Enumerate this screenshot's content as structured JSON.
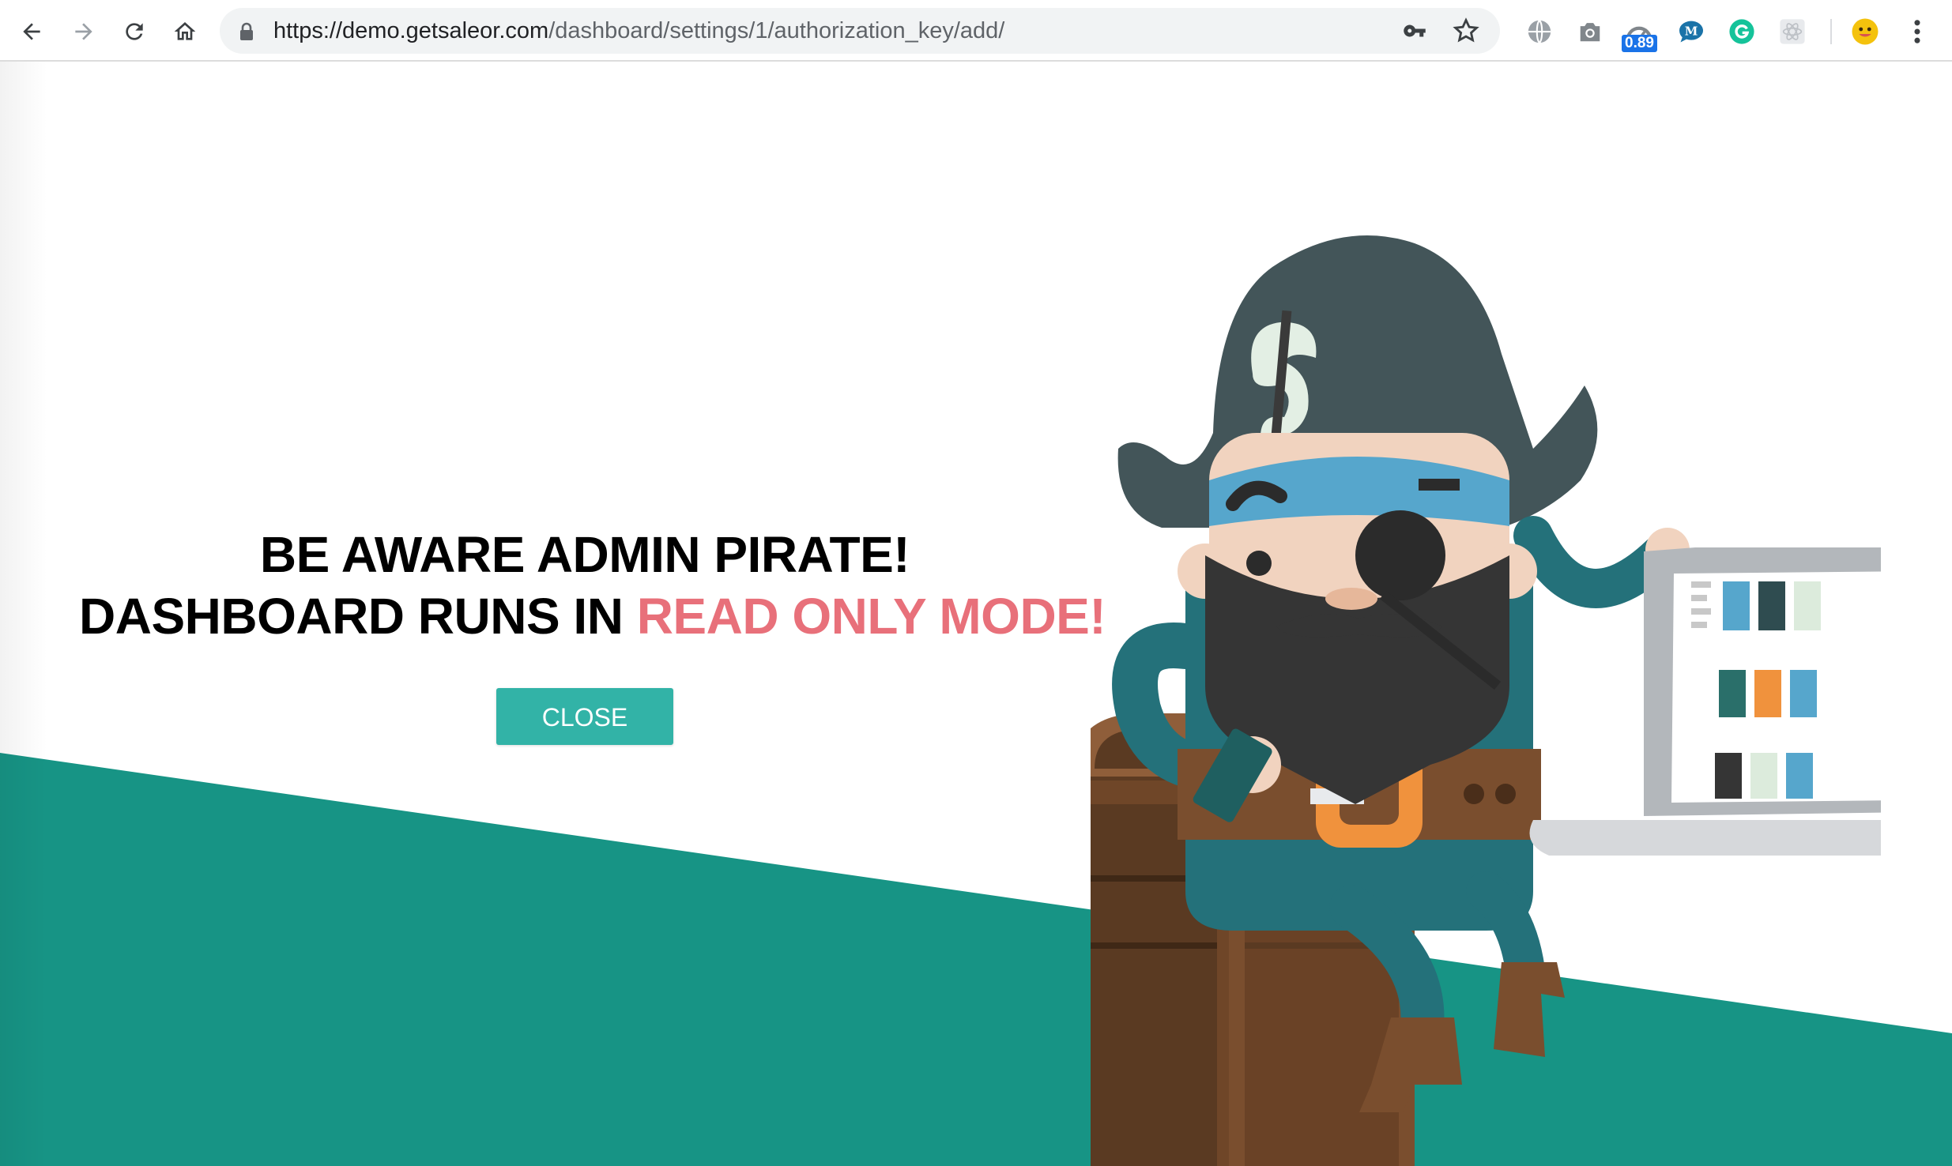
{
  "browser": {
    "url_host": "https://demo.getsaleor.com",
    "url_path": "/dashboard/settings/1/authorization_key/add/",
    "extension_badge": "0.89",
    "icons": {
      "back": "arrow-left-icon",
      "forward": "arrow-right-icon",
      "reload": "reload-icon",
      "home": "home-icon",
      "lock": "lock-icon",
      "key": "key-icon",
      "bookmark": "star-icon",
      "menu": "kebab-menu-icon"
    }
  },
  "notice": {
    "line1": "BE AWARE ADMIN PIRATE!",
    "line2_prefix": "DASHBOARD RUNS IN ",
    "line2_highlight": "READ ONLY MODE!"
  },
  "close_button": {
    "label": "CLOSE"
  },
  "colors": {
    "teal": "#179485",
    "button": "#32b3a7",
    "highlight": "#e8707a"
  }
}
